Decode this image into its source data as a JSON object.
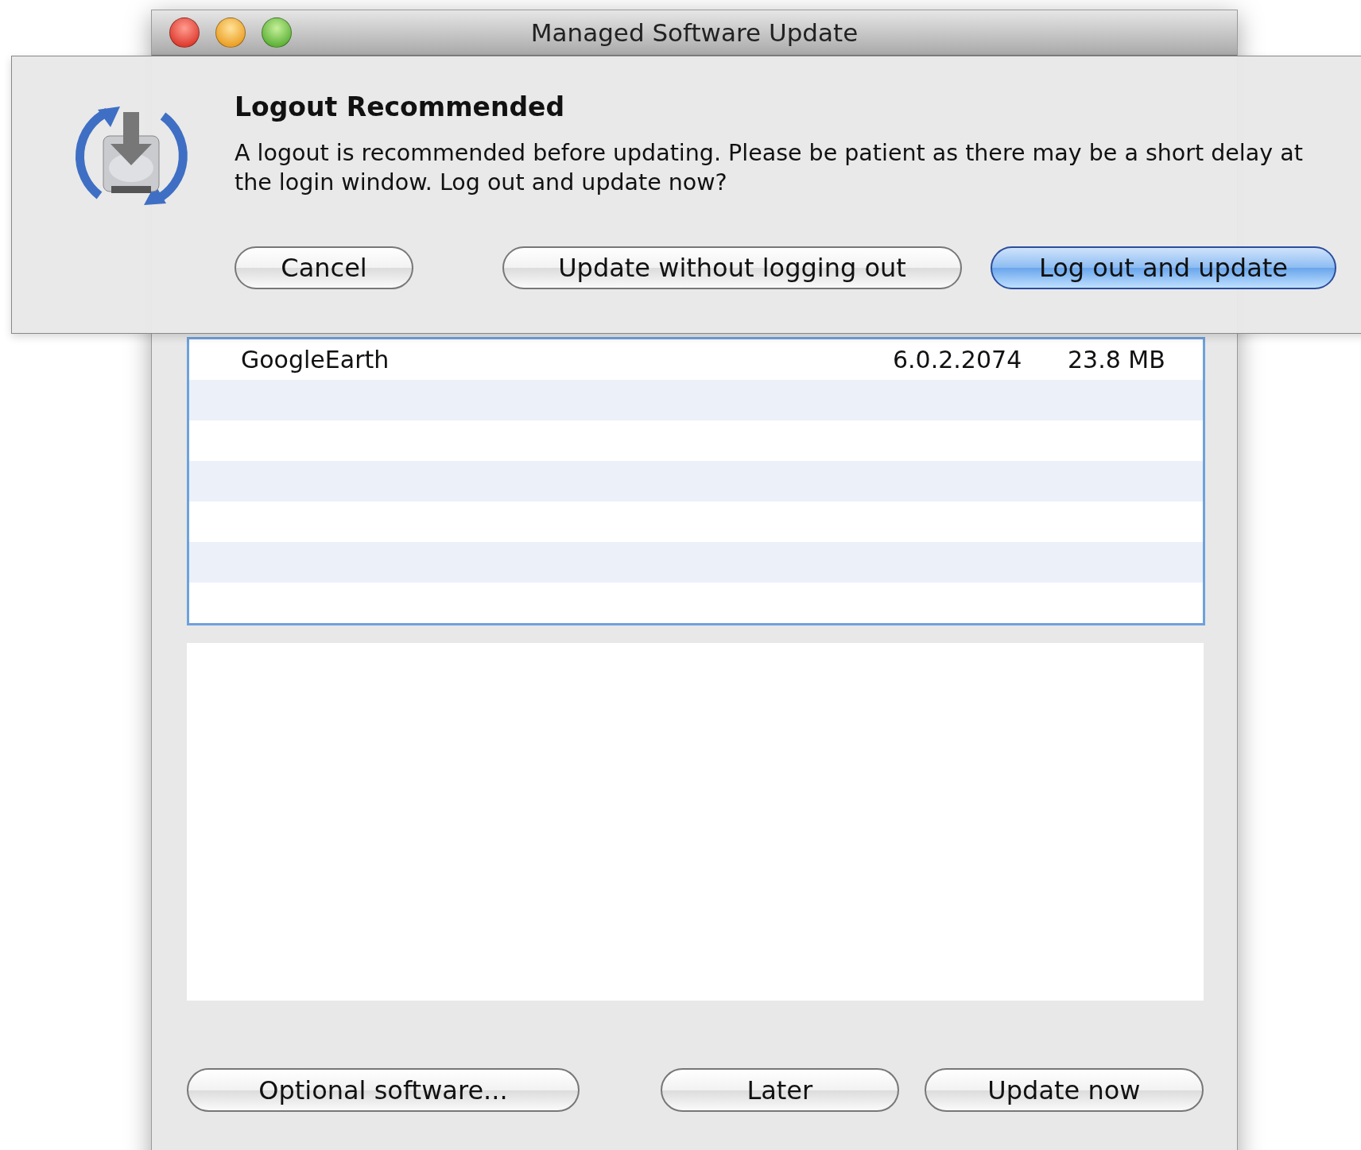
{
  "window": {
    "title": "Managed Software Update"
  },
  "sheet": {
    "title": "Logout Recommended",
    "message": "A logout is recommended before updating. Please be patient as there may be a short delay at the login window. Log out and update now?",
    "buttons": [
      {
        "label": "Cancel",
        "default": false
      },
      {
        "label": "Update without logging out",
        "default": false
      },
      {
        "label": "Log out and update",
        "default": true
      }
    ]
  },
  "table": {
    "rows": [
      {
        "name": "GoogleEarth",
        "version": "6.0.2.2074",
        "size": "23.8 MB"
      }
    ]
  },
  "buttons": [
    {
      "label": "Optional software..."
    },
    {
      "label": "Later"
    },
    {
      "label": "Update now"
    }
  ]
}
